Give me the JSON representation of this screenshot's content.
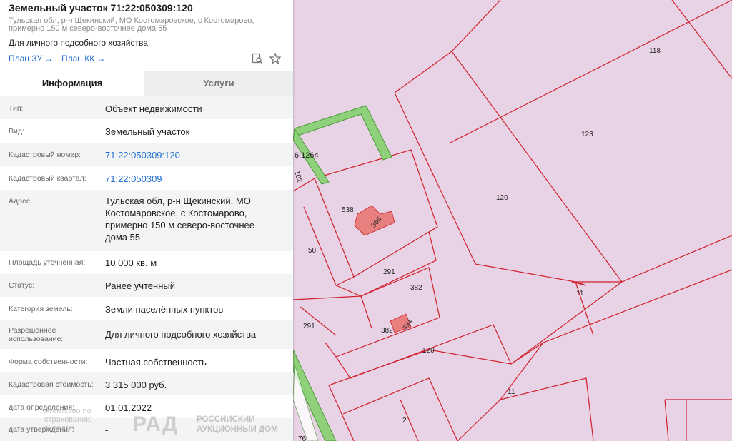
{
  "parcel": {
    "title": "Земельный участок 71:22:050309:120",
    "address_short": "Тульская обл, р-н Щекинский, МО Костомаровское, с Костомарово, примерно 150 м северо-восточнее дома 55",
    "purpose": "Для личного подсобного хозяйства"
  },
  "links": {
    "plan_zu": "План ЗУ",
    "plan_kk": "План КК",
    "arrow": "→"
  },
  "icons": {
    "search_doc": "search-document-icon",
    "favorite": "star-icon"
  },
  "tabs": [
    {
      "label": "Информация",
      "active": true
    },
    {
      "label": "Услуги",
      "active": false
    }
  ],
  "info_rows": [
    {
      "label": "Тип:",
      "value": "Объект недвижимости"
    },
    {
      "label": "Вид:",
      "value": "Земельный участок"
    },
    {
      "label": "Кадастровый номер:",
      "value": "71:22:050309:120"
    },
    {
      "label": "Кадастровый квартал:",
      "value": "71:22:050309"
    },
    {
      "label": "Адрес:",
      "value": "Тульская обл, р-н Щекинский, МО Костомаровское, с Костомарово, примерно 150 м северо-восточнее дома 55"
    },
    {
      "label": "Площадь уточненная:",
      "value": "10 000 кв. м"
    },
    {
      "label": "Статус:",
      "value": "Ранее учтенный"
    },
    {
      "label": "Категория земель:",
      "value": "Земли населённых пунктов"
    },
    {
      "label": "Разрешенное использование:",
      "value": "Для личного подсобного хозяйства"
    },
    {
      "label": "Форма собственности:",
      "value": "Частная собственность"
    },
    {
      "label": "Кадастровая стоимость:",
      "value": "3 315 000 руб."
    },
    {
      "label": "дата определения:",
      "value": "01.01.2022"
    },
    {
      "label": "дата утверждения:",
      "value": "-"
    }
  ],
  "watermarks": {
    "agency": "Агентство по страхованию вкладов",
    "rad_line1": "РОССИЙСКИЙ",
    "rad_line2": "АУКЦИОННЫЙ ДОМ",
    "rad_logo": "РАД"
  },
  "map": {
    "colors": {
      "background": "#e8d3e6",
      "parcel_border": "#d0202a",
      "road_fill": "#8fd07a",
      "road_border": "#4d9a3a",
      "building_fill": "#e88080"
    },
    "labels": {
      "p118": "118",
      "p123": "123",
      "p120": "120",
      "p538": "538",
      "p366": "366",
      "p50": "50",
      "p291a": "291",
      "p291b": "291",
      "p382a": "382",
      "p382b": "382",
      "p391": "391",
      "p120b": "120",
      "p11a": "11",
      "p11b": "11",
      "p2": "2",
      "p76": "76",
      "p102": "102",
      "p1264": "6:1264"
    }
  }
}
